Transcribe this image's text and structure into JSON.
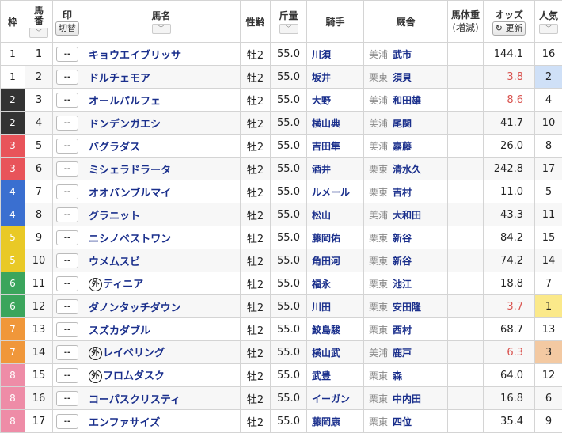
{
  "header": {
    "waku": "枠",
    "umaban": "馬\n番",
    "mark": "印",
    "mark_btn": "切替",
    "name": "馬名",
    "sexage": "性齢",
    "weight": "斤量",
    "jockey": "騎手",
    "stable": "厩舎",
    "body_weight": "馬体重",
    "body_weight_sub": "(増減)",
    "odds": "オッズ",
    "refresh_btn": "更新",
    "popularity": "人気",
    "sort_icon": "chevron-down-icon"
  },
  "waku_colors": {
    "1": {
      "bg": "#ffffff",
      "fg": "#222222"
    },
    "2": {
      "bg": "#333333",
      "fg": "#ffffff"
    },
    "3": {
      "bg": "#e8545a",
      "fg": "#ffffff"
    },
    "4": {
      "bg": "#3a6fd0",
      "fg": "#ffffff"
    },
    "5": {
      "bg": "#e9c926",
      "fg": "#ffffff"
    },
    "6": {
      "bg": "#3ba55c",
      "fg": "#ffffff"
    },
    "7": {
      "bg": "#f0973a",
      "fg": "#ffffff"
    },
    "8": {
      "bg": "#ee8ca7",
      "fg": "#ffffff"
    }
  },
  "rows": [
    {
      "waku": "1",
      "umaban": "1",
      "mark": "--",
      "foreign": false,
      "name": "キョウエイブリッサ",
      "sexage": "牡2",
      "weight": "55.0",
      "jockey": "川須",
      "area": "美浦",
      "trainer": "武市",
      "odds": "144.1",
      "odds_red": false,
      "pop": "16",
      "pop_bg": ""
    },
    {
      "waku": "1",
      "umaban": "2",
      "mark": "--",
      "foreign": false,
      "name": "ドルチェモア",
      "sexage": "牡2",
      "weight": "55.0",
      "jockey": "坂井",
      "area": "栗東",
      "trainer": "須貝",
      "odds": "3.8",
      "odds_red": true,
      "pop": "2",
      "pop_bg": "#cfe0f7"
    },
    {
      "waku": "2",
      "umaban": "3",
      "mark": "--",
      "foreign": false,
      "name": "オールパルフェ",
      "sexage": "牡2",
      "weight": "55.0",
      "jockey": "大野",
      "area": "美浦",
      "trainer": "和田雄",
      "odds": "8.6",
      "odds_red": true,
      "pop": "4",
      "pop_bg": ""
    },
    {
      "waku": "2",
      "umaban": "4",
      "mark": "--",
      "foreign": false,
      "name": "ドンデンガエシ",
      "sexage": "牡2",
      "weight": "55.0",
      "jockey": "横山典",
      "area": "美浦",
      "trainer": "尾関",
      "odds": "41.7",
      "odds_red": false,
      "pop": "10",
      "pop_bg": ""
    },
    {
      "waku": "3",
      "umaban": "5",
      "mark": "--",
      "foreign": false,
      "name": "バグラダス",
      "sexage": "牡2",
      "weight": "55.0",
      "jockey": "吉田隼",
      "area": "美浦",
      "trainer": "嘉藤",
      "odds": "26.0",
      "odds_red": false,
      "pop": "8",
      "pop_bg": ""
    },
    {
      "waku": "3",
      "umaban": "6",
      "mark": "--",
      "foreign": false,
      "name": "ミシェラドラータ",
      "sexage": "牡2",
      "weight": "55.0",
      "jockey": "酒井",
      "area": "栗東",
      "trainer": "清水久",
      "odds": "242.8",
      "odds_red": false,
      "pop": "17",
      "pop_bg": ""
    },
    {
      "waku": "4",
      "umaban": "7",
      "mark": "--",
      "foreign": false,
      "name": "オオバンブルマイ",
      "sexage": "牡2",
      "weight": "55.0",
      "jockey": "ルメール",
      "area": "栗東",
      "trainer": "吉村",
      "odds": "11.0",
      "odds_red": false,
      "pop": "5",
      "pop_bg": ""
    },
    {
      "waku": "4",
      "umaban": "8",
      "mark": "--",
      "foreign": false,
      "name": "グラニット",
      "sexage": "牡2",
      "weight": "55.0",
      "jockey": "松山",
      "area": "美浦",
      "trainer": "大和田",
      "odds": "43.3",
      "odds_red": false,
      "pop": "11",
      "pop_bg": ""
    },
    {
      "waku": "5",
      "umaban": "9",
      "mark": "--",
      "foreign": false,
      "name": "ニシノベストワン",
      "sexage": "牡2",
      "weight": "55.0",
      "jockey": "藤岡佑",
      "area": "栗東",
      "trainer": "新谷",
      "odds": "84.2",
      "odds_red": false,
      "pop": "15",
      "pop_bg": ""
    },
    {
      "waku": "5",
      "umaban": "10",
      "mark": "--",
      "foreign": false,
      "name": "ウメムスビ",
      "sexage": "牡2",
      "weight": "55.0",
      "jockey": "角田河",
      "area": "栗東",
      "trainer": "新谷",
      "odds": "74.2",
      "odds_red": false,
      "pop": "14",
      "pop_bg": ""
    },
    {
      "waku": "6",
      "umaban": "11",
      "mark": "--",
      "foreign": true,
      "name": "ティニア",
      "sexage": "牡2",
      "weight": "55.0",
      "jockey": "福永",
      "area": "栗東",
      "trainer": "池江",
      "odds": "18.8",
      "odds_red": false,
      "pop": "7",
      "pop_bg": ""
    },
    {
      "waku": "6",
      "umaban": "12",
      "mark": "--",
      "foreign": false,
      "name": "ダノンタッチダウン",
      "sexage": "牡2",
      "weight": "55.0",
      "jockey": "川田",
      "area": "栗東",
      "trainer": "安田隆",
      "odds": "3.7",
      "odds_red": true,
      "pop": "1",
      "pop_bg": "#fbe98a"
    },
    {
      "waku": "7",
      "umaban": "13",
      "mark": "--",
      "foreign": false,
      "name": "スズカダブル",
      "sexage": "牡2",
      "weight": "55.0",
      "jockey": "鮫島駿",
      "area": "栗東",
      "trainer": "西村",
      "odds": "68.7",
      "odds_red": false,
      "pop": "13",
      "pop_bg": ""
    },
    {
      "waku": "7",
      "umaban": "14",
      "mark": "--",
      "foreign": true,
      "name": "レイベリング",
      "sexage": "牡2",
      "weight": "55.0",
      "jockey": "横山武",
      "area": "美浦",
      "trainer": "鹿戸",
      "odds": "6.3",
      "odds_red": true,
      "pop": "3",
      "pop_bg": "#f3c9a2"
    },
    {
      "waku": "8",
      "umaban": "15",
      "mark": "--",
      "foreign": true,
      "name": "フロムダスク",
      "sexage": "牡2",
      "weight": "55.0",
      "jockey": "武豊",
      "area": "栗東",
      "trainer": "森",
      "odds": "64.0",
      "odds_red": false,
      "pop": "12",
      "pop_bg": ""
    },
    {
      "waku": "8",
      "umaban": "16",
      "mark": "--",
      "foreign": false,
      "name": "コーパスクリスティ",
      "sexage": "牡2",
      "weight": "55.0",
      "jockey": "イーガン",
      "area": "栗東",
      "trainer": "中内田",
      "odds": "16.8",
      "odds_red": false,
      "pop": "6",
      "pop_bg": ""
    },
    {
      "waku": "8",
      "umaban": "17",
      "mark": "--",
      "foreign": false,
      "name": "エンファサイズ",
      "sexage": "牡2",
      "weight": "55.0",
      "jockey": "藤岡康",
      "area": "栗東",
      "trainer": "四位",
      "odds": "35.4",
      "odds_red": false,
      "pop": "9",
      "pop_bg": ""
    }
  ],
  "foreign_mark": "外"
}
